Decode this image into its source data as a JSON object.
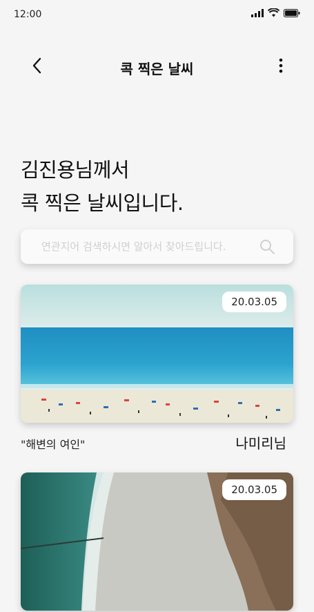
{
  "status": {
    "time": "12:00"
  },
  "header": {
    "title": "콕 찍은 날씨"
  },
  "headline": {
    "line1": "김진용님께서",
    "line2": "콕 찍은 날씨입니다."
  },
  "search": {
    "placeholder": "연관지어 검색하시면 알아서 찾아드립니다."
  },
  "cards": [
    {
      "date": "20.03.05",
      "caption": "\"해변의 여인\"",
      "author": "나미리님"
    },
    {
      "date": "20.03.05"
    }
  ],
  "icons": [
    "back-arrow-icon",
    "more-vertical-icon",
    "search-icon",
    "signal-icon",
    "wifi-icon",
    "battery-icon"
  ],
  "colors": {
    "background": "#f5f5f5",
    "text": "#111111",
    "placeholder": "#cfcfcf"
  }
}
